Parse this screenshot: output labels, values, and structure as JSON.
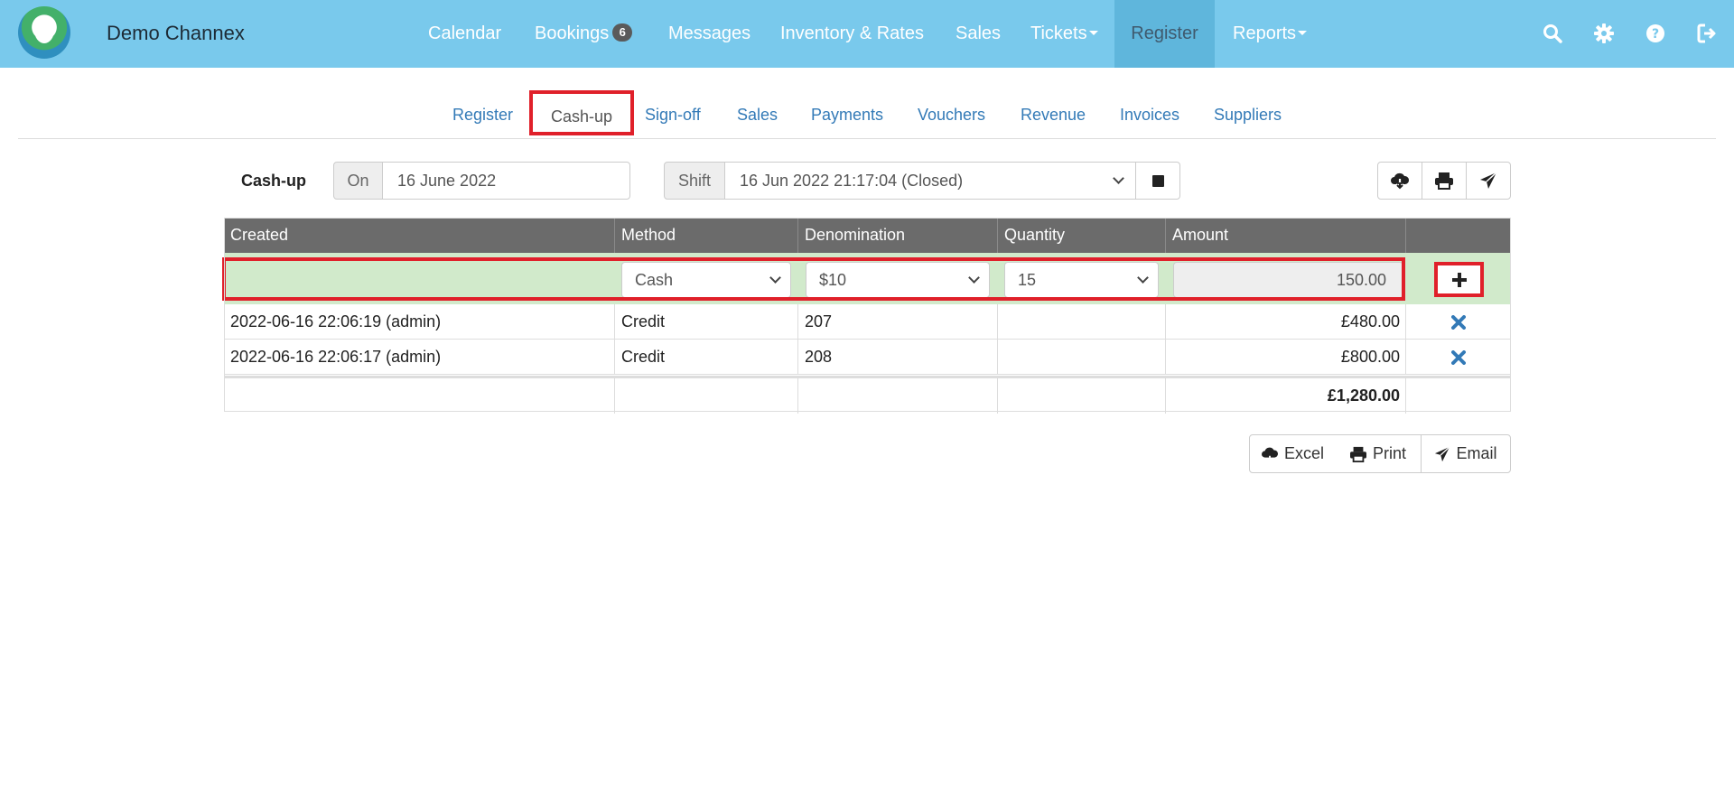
{
  "brand": {
    "name": "Demo Channex"
  },
  "nav": {
    "calendar": "Calendar",
    "bookings": "Bookings",
    "bookings_count": "6",
    "messages": "Messages",
    "inventory": "Inventory & Rates",
    "sales": "Sales",
    "tickets": "Tickets",
    "register": "Register",
    "reports": "Reports",
    "icons": [
      "search-icon",
      "gear-icon",
      "help-icon",
      "logout-icon"
    ]
  },
  "subtabs": [
    "Register",
    "Cash-up",
    "Sign-off",
    "Sales",
    "Payments",
    "Vouchers",
    "Revenue",
    "Invoices",
    "Suppliers"
  ],
  "toolbar": {
    "label": "Cash-up",
    "on_label": "On",
    "date": "16 June 2022",
    "shift_label": "Shift",
    "shift_value": "16 Jun 2022 21:17:04 (Closed)"
  },
  "table": {
    "headers": [
      "Created",
      "Method",
      "Denomination",
      "Quantity",
      "Amount"
    ],
    "new_row": {
      "method": "Cash",
      "denomination": "$10",
      "quantity": "15",
      "amount": "150.00"
    },
    "rows": [
      {
        "created": "2022-06-16 22:06:19 (admin)",
        "method": "Credit",
        "denomination": "207",
        "quantity": "",
        "amount": "£480.00"
      },
      {
        "created": "2022-06-16 22:06:17 (admin)",
        "method": "Credit",
        "denomination": "208",
        "quantity": "",
        "amount": "£800.00"
      }
    ],
    "total": "£1,280.00"
  },
  "actions": {
    "excel": "Excel",
    "print": "Print",
    "email": "Email"
  },
  "colors": {
    "navbar": "#79c9ec",
    "highlight": "#e0202a",
    "new_row": "#d1eacb",
    "header": "#6b6b6b",
    "link": "#337ab7"
  }
}
